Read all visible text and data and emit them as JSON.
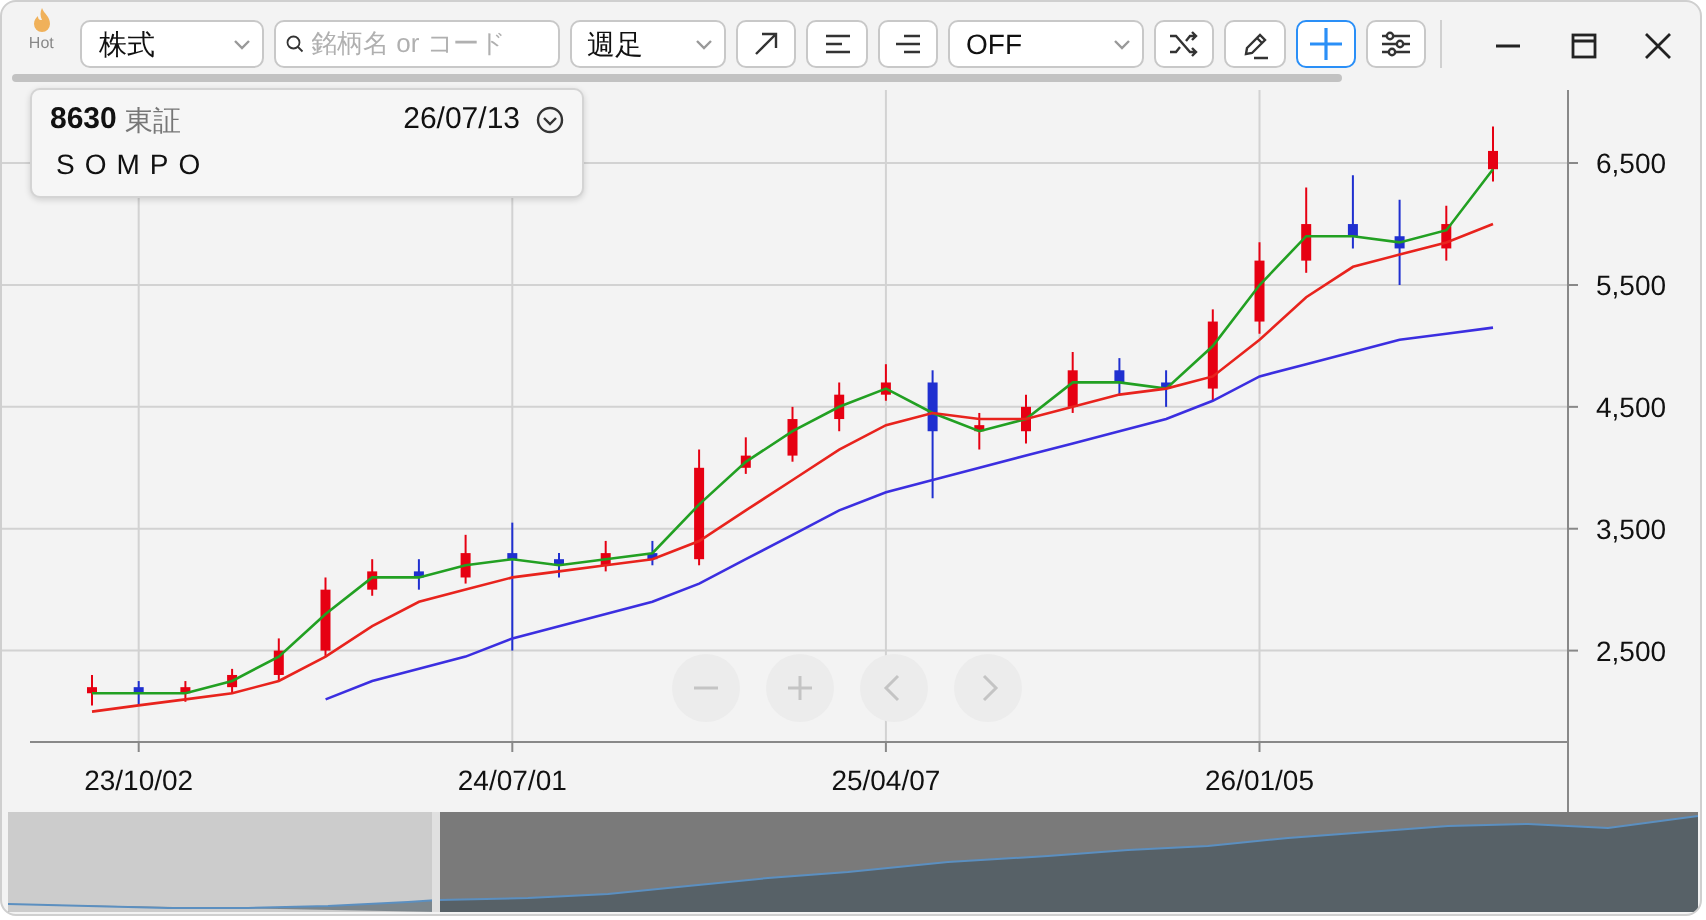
{
  "toolbar": {
    "logo_label": "Hot",
    "market_select": "株式",
    "search": {
      "placeholder": "銘柄名 or コード"
    },
    "period_select": "週足",
    "tools": [
      {
        "kind": "arrow",
        "selected": false
      },
      {
        "kind": "align-left",
        "selected": false
      },
      {
        "kind": "align-right",
        "selected": false
      }
    ],
    "overlay_select": "OFF",
    "tools_2": [
      {
        "kind": "shuffle",
        "selected": false
      },
      {
        "kind": "pencil",
        "selected": false
      },
      {
        "kind": "crosshair",
        "selected": true
      },
      {
        "kind": "sliders",
        "selected": false
      }
    ]
  },
  "info_card": {
    "code": "8630",
    "market": "東証",
    "date": "26/07/13",
    "name": "SOMPO"
  },
  "chart": {
    "chart_data": {
      "type": "candlestick",
      "categories": [
        null,
        "23/10/02",
        null,
        null,
        null,
        null,
        null,
        null,
        null,
        "24/07/01",
        null,
        null,
        null,
        null,
        null,
        null,
        null,
        "25/04/07",
        null,
        null,
        null,
        null,
        null,
        null,
        null,
        "26/01/05",
        null,
        null,
        null,
        null,
        null
      ],
      "ylim": [
        1750,
        7100
      ],
      "grid": true,
      "yticks": [
        {
          "value": 2500,
          "label": "2,500"
        },
        {
          "value": 3500,
          "label": "3,500"
        },
        {
          "value": 4500,
          "label": "4,500"
        },
        {
          "value": 5500,
          "label": "5,500"
        },
        {
          "value": 6500,
          "label": "6,500"
        }
      ],
      "ohlc": [
        [
          2150,
          2300,
          2050,
          2200
        ],
        [
          2200,
          2250,
          2050,
          2150
        ],
        [
          2150,
          2250,
          2080,
          2200
        ],
        [
          2200,
          2350,
          2150,
          2300
        ],
        [
          2300,
          2600,
          2250,
          2500
        ],
        [
          2500,
          3100,
          2450,
          3000
        ],
        [
          3000,
          3250,
          2950,
          3150
        ],
        [
          3150,
          3250,
          3000,
          3100
        ],
        [
          3100,
          3450,
          3050,
          3300
        ],
        [
          3300,
          3550,
          2500,
          3250
        ],
        [
          3250,
          3300,
          3100,
          3200
        ],
        [
          3200,
          3400,
          3150,
          3300
        ],
        [
          3300,
          3400,
          3200,
          3250
        ],
        [
          3250,
          4150,
          3200,
          4000
        ],
        [
          4000,
          4250,
          3950,
          4100
        ],
        [
          4100,
          4500,
          4050,
          4400
        ],
        [
          4400,
          4700,
          4300,
          4600
        ],
        [
          4600,
          4850,
          4550,
          4700
        ],
        [
          4700,
          4800,
          3750,
          4300
        ],
        [
          4300,
          4450,
          4150,
          4350
        ],
        [
          4300,
          4600,
          4200,
          4500
        ],
        [
          4500,
          4950,
          4450,
          4800
        ],
        [
          4800,
          4900,
          4600,
          4700
        ],
        [
          4700,
          4800,
          4500,
          4650
        ],
        [
          4650,
          5300,
          4550,
          5200
        ],
        [
          5200,
          5850,
          5100,
          5700
        ],
        [
          5700,
          6300,
          5600,
          6000
        ],
        [
          6000,
          6400,
          5800,
          5900
        ],
        [
          5900,
          6200,
          5500,
          5800
        ],
        [
          5800,
          6150,
          5700,
          6000
        ],
        [
          6450,
          6800,
          6350,
          6600
        ]
      ],
      "series": [
        {
          "type": "line",
          "color": "#22a022",
          "values": [
            2150,
            2150,
            2150,
            2250,
            2450,
            2800,
            3100,
            3100,
            3200,
            3250,
            3200,
            3250,
            3300,
            3700,
            4050,
            4300,
            4500,
            4650,
            4450,
            4300,
            4400,
            4700,
            4700,
            4650,
            5000,
            5500,
            5900,
            5900,
            5850,
            5950,
            6450
          ]
        },
        {
          "type": "line",
          "color": "#e8231d",
          "values": [
            2000,
            2050,
            2100,
            2150,
            2250,
            2450,
            2700,
            2900,
            3000,
            3100,
            3150,
            3200,
            3250,
            3400,
            3650,
            3900,
            4150,
            4350,
            4450,
            4400,
            4400,
            4500,
            4600,
            4650,
            4750,
            5050,
            5400,
            5650,
            5750,
            5850,
            6000
          ]
        },
        {
          "type": "line",
          "color": "#3b2ee0",
          "values": [
            null,
            null,
            null,
            null,
            null,
            2100,
            2250,
            2350,
            2450,
            2600,
            2700,
            2800,
            2900,
            3050,
            3250,
            3450,
            3650,
            3800,
            3900,
            4000,
            4100,
            4200,
            4300,
            4400,
            4550,
            4750,
            4850,
            4950,
            5050,
            5100,
            5150
          ]
        }
      ]
    }
  }
}
